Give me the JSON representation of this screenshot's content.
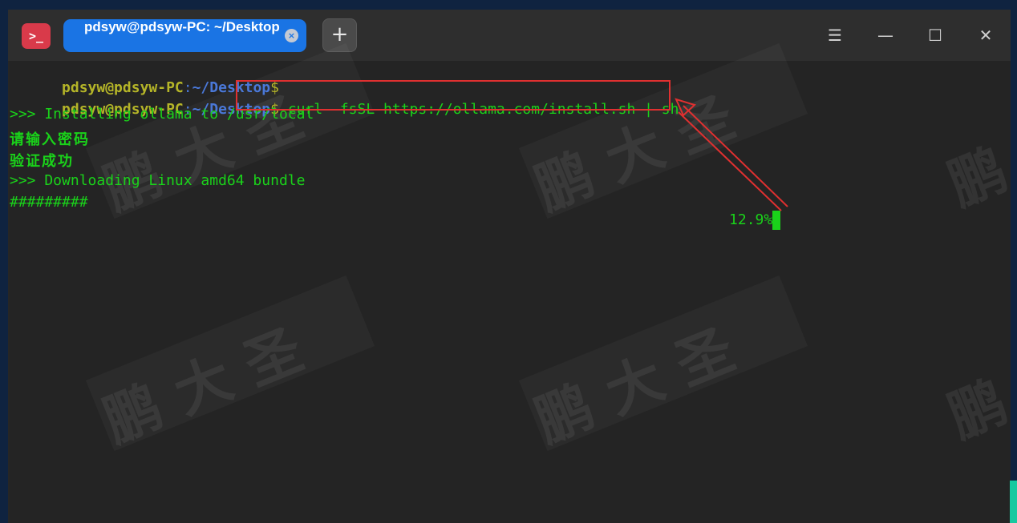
{
  "titlebar": {
    "app_icon_glyph": ">_",
    "tab_title": "pdsyw@pdsyw-PC: ~/Desktop",
    "tab_close_glyph": "×",
    "new_tab_glyph": "+",
    "menu_glyph": "☰",
    "minimize_glyph": "—",
    "maximize_glyph": "☐",
    "close_glyph": "✕"
  },
  "terminal": {
    "prompt_user": "pdsyw@pdsyw-PC",
    "prompt_sep": ":",
    "prompt_path": "~/Desktop",
    "prompt_dollar": "$",
    "command": " curl -fsSL https://ollama.com/install.sh | sh",
    "line_installing": ">>> Installing ollama to /usr/local",
    "line_password": "请输入密码",
    "line_verified": "验证成功",
    "line_downloading": ">>> Downloading Linux amd64 bundle",
    "progress_bar_text": "#########",
    "progress_percent": "12.9%"
  },
  "watermark": {
    "char1": "鹏",
    "char2": "大",
    "char3": "圣"
  },
  "colors": {
    "accent_tab": "#1a74e4",
    "terminal_bg": "#242424",
    "output_green": "#1ad21a",
    "prompt_user": "#b5b528",
    "prompt_path": "#4a78d8",
    "annotation_red": "#e03030"
  }
}
